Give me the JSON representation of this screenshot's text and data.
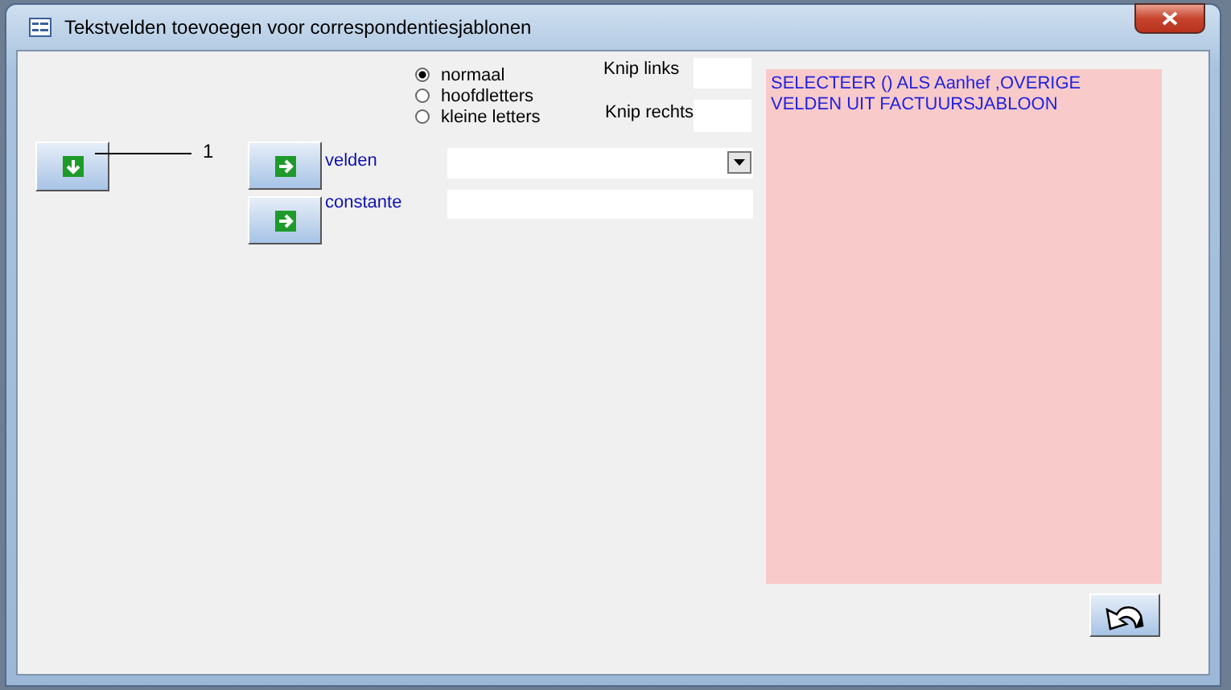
{
  "window": {
    "title": "Tekstvelden toevoegen voor correspondentiesjablonen"
  },
  "case_options": [
    {
      "label": "normaal",
      "selected": true
    },
    {
      "label": "hoofdletters",
      "selected": false
    },
    {
      "label": "kleine letters",
      "selected": false
    }
  ],
  "knip_links": {
    "label": "Knip links"
  },
  "knip_rechts": {
    "label": "Knip rechts"
  },
  "counter": "1",
  "velden": {
    "label": "velden"
  },
  "constante": {
    "label": "constante"
  },
  "note": "SELECTEER () ALS Aanhef ,OVERIGE VELDEN UIT FACTUURSJABLOON"
}
